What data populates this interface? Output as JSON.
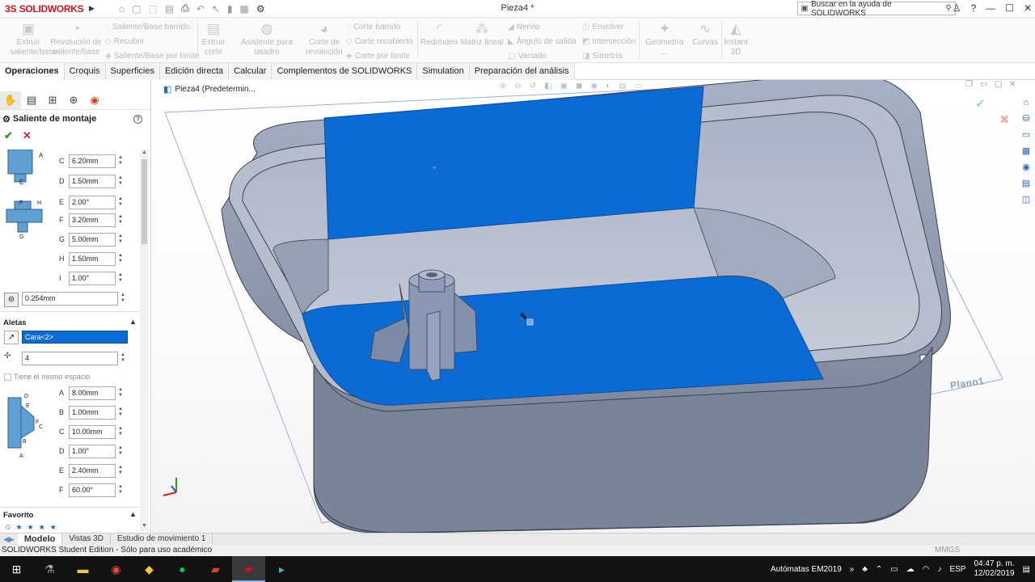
{
  "app": {
    "brand": "SOLIDWORKS",
    "document_title": "Pieza4 *",
    "help_placeholder": "Buscar en la ayuda de SOLIDWORKS",
    "window_controls": [
      "—",
      "☐",
      "✕"
    ]
  },
  "ribbon": {
    "extruir_saliente": "Extruir saliente/base",
    "revolucion_saliente": "Revolución de saliente/base",
    "saliente_barrido": "Saliente/Base barrido",
    "recubrir": "Recubrir",
    "saliente_limite": "Saliente/Base por límite",
    "extruir_corte": "Extruir corte",
    "asistente_taladro": "Asistente para taladro",
    "corte_revolucion": "Corte de revolución",
    "corte_barrido": "Corte barrido",
    "corte_recubierto": "Corte recubierto",
    "corte_limite": "Corte por límite",
    "redondeo": "Redondeo",
    "matriz_lineal": "Matriz lineal",
    "nervio": "Nervio",
    "angulo_salida": "Ángulo de salida",
    "vaciado": "Vaciado",
    "envolver": "Envolver",
    "interseccion": "Intersección",
    "simetria": "Simetría",
    "geometria": "Geometría ...",
    "curvas": "Curvas",
    "instant3d": "Instant 3D"
  },
  "tabs": [
    "Operaciones",
    "Croquis",
    "Superficies",
    "Edición directa",
    "Calcular",
    "Complementos de SOLIDWORKS",
    "Simulation",
    "Preparación del análisis"
  ],
  "property_manager": {
    "title": "Saliente de montaje",
    "help": "?",
    "top_fields": [
      {
        "label": "C",
        "value": "6.20mm"
      },
      {
        "label": "D",
        "value": "1.50mm"
      },
      {
        "label": "E",
        "value": "2.00°"
      },
      {
        "label": "F",
        "value": "3.20mm"
      },
      {
        "label": "G",
        "value": "5.00mm"
      },
      {
        "label": "H",
        "value": "1.50mm"
      },
      {
        "label": "I",
        "value": "1.00°"
      }
    ],
    "clearance_value": "0.254mm",
    "aletas": {
      "header": "Aletas",
      "face_selection": "Cara<2>",
      "count": "4",
      "same_spacing": "Tiene el mismo espacio",
      "fields": [
        {
          "label": "A",
          "value": "8.00mm"
        },
        {
          "label": "B",
          "value": "1.00mm"
        },
        {
          "label": "C",
          "value": "10.00mm"
        },
        {
          "label": "D",
          "value": "1.00°"
        },
        {
          "label": "E",
          "value": "2.40mm"
        },
        {
          "label": "F",
          "value": "60.00°"
        }
      ]
    },
    "favorito": "Favorito"
  },
  "viewport": {
    "tree_root": "Pieza4  (Predetermin...",
    "plane_label": "Plano1"
  },
  "bottom_tabs": [
    "Modelo",
    "Vistas 3D",
    "Estudio de movimiento 1"
  ],
  "status": {
    "text": "SOLIDWORKS Student Edition - Sólo para uso académico",
    "units": "MMGS"
  },
  "taskbar": {
    "automatas": "Autómatas EM2019",
    "language": "ESP",
    "time": "04:47 p. m.",
    "date": "12/02/2019"
  },
  "colors": {
    "selection_blue": "#0b6bd3",
    "model_gray": "#9aa3b7",
    "brand_red": "#d0121b"
  }
}
